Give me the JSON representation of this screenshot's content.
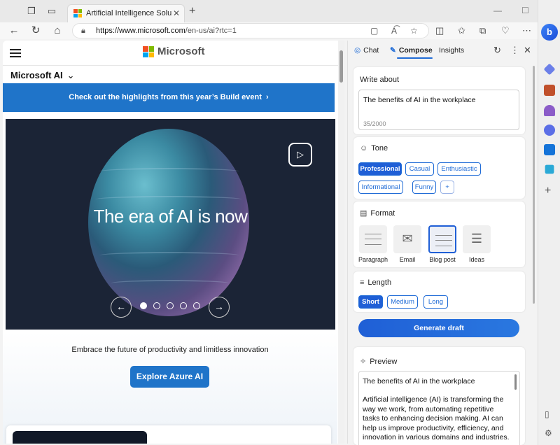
{
  "browser": {
    "tab_title": "Artificial Intelligence Solutions | M",
    "url_host": "https://www.microsoft.com",
    "url_path": "/en-us/ai?rtc=1",
    "sidebar_brand": "b"
  },
  "page": {
    "brand": "Microsoft",
    "sub_nav": "Microsoft AI",
    "promo": "Check out the highlights from this year’s Build event",
    "hero_title": "The era of AI is now",
    "tagline": "Embrace the future of productivity and limitless innovation",
    "cta": "Explore Azure AI",
    "carousel_dots": 5,
    "carousel_active": 1
  },
  "copilot": {
    "tabs": [
      {
        "label": "Chat"
      },
      {
        "label": "Compose"
      },
      {
        "label": "Insights"
      }
    ],
    "write_about": {
      "label": "Write about",
      "value": "The benefits of AI in the workplace",
      "count": "35/2000"
    },
    "tone": {
      "label": "Tone",
      "options": [
        "Professional",
        "Casual",
        "Enthusiastic",
        "Informational",
        "Funny"
      ],
      "selected": "Professional"
    },
    "format": {
      "label": "Format",
      "options": [
        "Paragraph",
        "Email",
        "Blog post",
        "Ideas"
      ],
      "selected": "Blog post"
    },
    "length": {
      "label": "Length",
      "options": [
        "Short",
        "Medium",
        "Long"
      ],
      "selected": "Short"
    },
    "generate": "Generate draft",
    "preview": {
      "label": "Preview",
      "title": "The benefits of AI in the workplace",
      "body": "Artificial intelligence (AI) is transforming the way we work, from automating repetitive tasks to enhancing decision making. AI can help us improve productivity, efficiency, and innovation in various domains and industries."
    }
  },
  "colors": {
    "accent": "#1f5fd6",
    "ms_blue": "#1f74c9"
  }
}
